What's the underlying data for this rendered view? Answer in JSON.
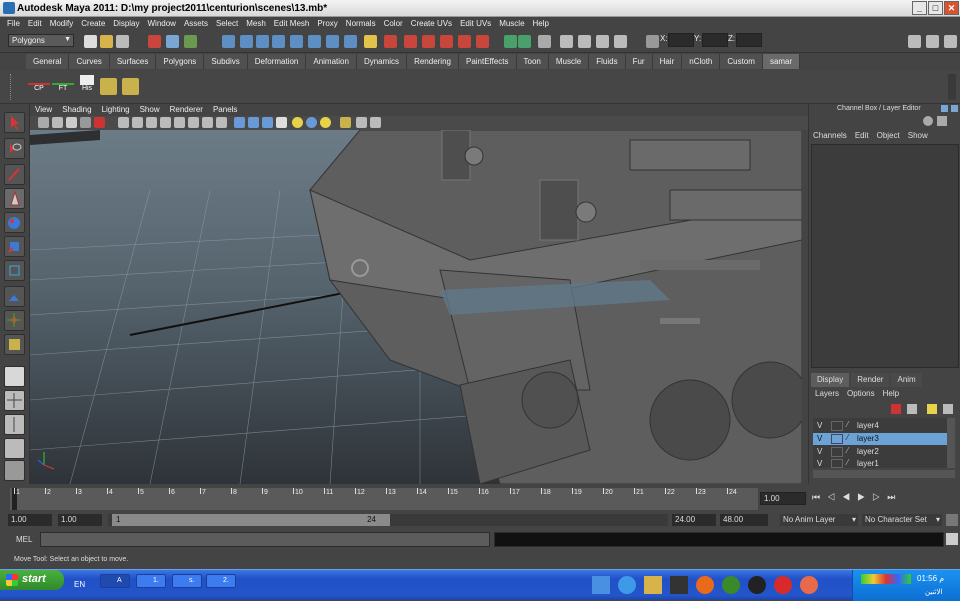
{
  "window": {
    "title": "Autodesk Maya 2011: D:\\my project2011\\centurion\\scenes\\13.mb*",
    "min": "_",
    "max": "□",
    "close": "✕"
  },
  "menu": [
    "File",
    "Edit",
    "Modify",
    "Create",
    "Display",
    "Window",
    "Assets",
    "Select",
    "Mesh",
    "Edit Mesh",
    "Proxy",
    "Normals",
    "Color",
    "Create UVs",
    "Edit UVs",
    "Muscle",
    "Help"
  ],
  "status": {
    "mode": "Polygons",
    "x_label": "X:",
    "y_label": "Y:",
    "z_label": "Z:"
  },
  "shelf_tabs": [
    "General",
    "Curves",
    "Surfaces",
    "Polygons",
    "Subdivs",
    "Deformation",
    "Animation",
    "Dynamics",
    "Rendering",
    "PaintEffects",
    "Toon",
    "Muscle",
    "Fluids",
    "Fur",
    "Hair",
    "nCloth",
    "Custom",
    "samar"
  ],
  "shelf_active": "samar",
  "shelf_buttons": [
    "CP",
    "FT",
    "His"
  ],
  "panel_menu": [
    "View",
    "Shading",
    "Lighting",
    "Show",
    "Renderer",
    "Panels"
  ],
  "channel_box": {
    "title": "Channel Box / Layer Editor",
    "menu": [
      "Channels",
      "Edit",
      "Object",
      "Show"
    ],
    "tabs": [
      "Display",
      "Render",
      "Anim"
    ],
    "active_tab": "Display",
    "layer_menu": [
      "Layers",
      "Options",
      "Help"
    ],
    "layers": [
      {
        "v": "V",
        "name": "layer4",
        "selected": false
      },
      {
        "v": "V",
        "name": "layer3",
        "selected": true
      },
      {
        "v": "V",
        "name": "layer2",
        "selected": false
      },
      {
        "v": "V",
        "name": "layer1",
        "selected": false
      }
    ]
  },
  "timeline": {
    "ticks": [
      "1",
      "2",
      "3",
      "4",
      "5",
      "6",
      "7",
      "8",
      "9",
      "10",
      "11",
      "12",
      "13",
      "14",
      "15",
      "16",
      "17",
      "18",
      "19",
      "20",
      "21",
      "22",
      "23",
      "24"
    ],
    "current": "1.00"
  },
  "range": {
    "start": "1.00",
    "playback_start": "1.00",
    "slider_start": "1",
    "slider_end": "24",
    "playback_end": "24.00",
    "end": "48.00",
    "anim_layer": "No Anim Layer",
    "char_set": "No Character Set"
  },
  "cmd": {
    "label": "MEL"
  },
  "help_line": "Move Tool: Select an object to move.",
  "taskbar": {
    "start": "start",
    "lang": "EN",
    "buttons": [
      "A",
      "1.",
      "s.",
      "2."
    ],
    "clock": "01:56 م",
    "day": "الاثنين"
  },
  "colors": {
    "accent": "#5d8fc4",
    "selected_layer": "#6ba3d6",
    "viewport_top": "#6c7c86",
    "grid": "#8fa0aa"
  }
}
